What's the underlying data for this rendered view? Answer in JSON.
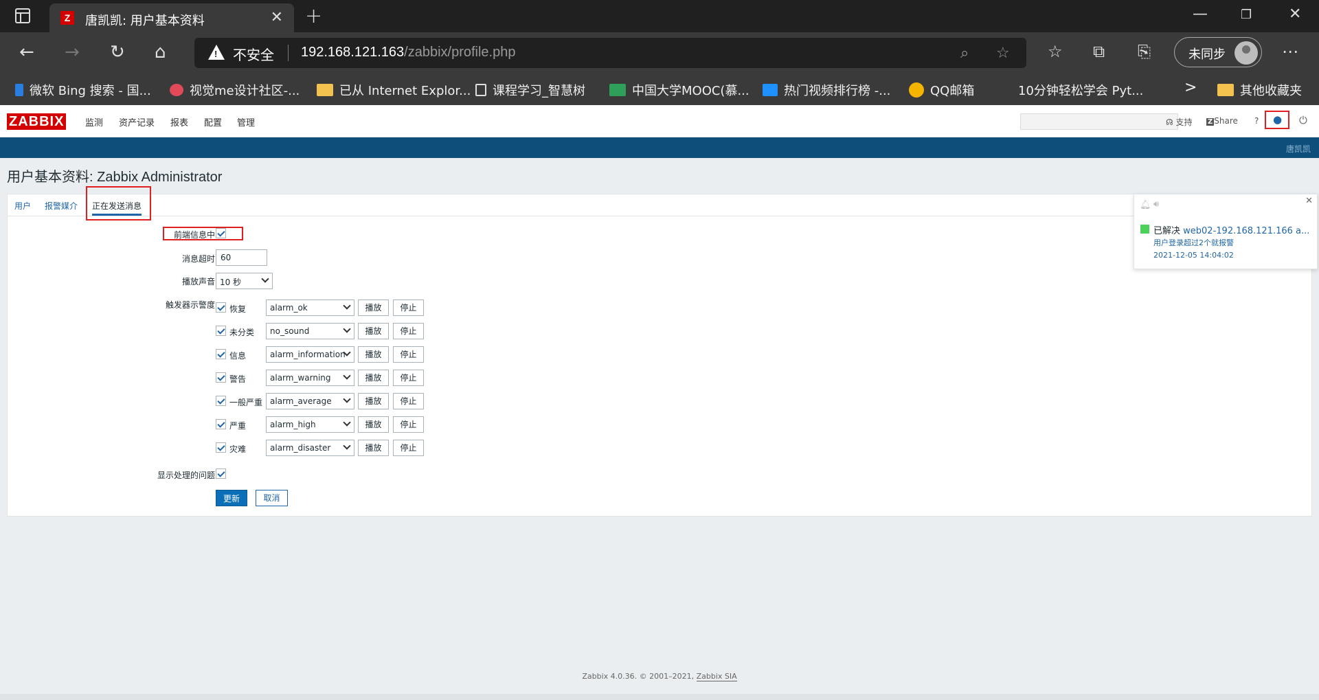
{
  "browser": {
    "tab_title": "唐凯凯: 用户基本资料",
    "tab_favicon": "Z",
    "address_insecure": "不安全",
    "address_host": "192.168.121.163",
    "address_path": "/zabbix/profile.php",
    "sync_label": "未同步",
    "bookmarks": [
      {
        "label": "微软 Bing 搜索 - 国...",
        "color": "#2a7de1"
      },
      {
        "label": "视觉me设计社区-...",
        "color": "#e24a5a"
      },
      {
        "label": "已从 Internet Explor...",
        "color": "#f2c14e"
      },
      {
        "label": "课程学习_智慧树",
        "color": "#e0e0e0"
      },
      {
        "label": "中国大学MOOC(慕...",
        "color": "#2fa05a"
      },
      {
        "label": "热门视频排行榜 -...",
        "color": "#1e90ff"
      },
      {
        "label": "QQ邮箱",
        "color": "#f4b400"
      },
      {
        "label": "10分钟轻松学会 Pyt...",
        "color": "#3a3a3a"
      },
      {
        "label": "其他收藏夹",
        "color": "#f2c14e"
      }
    ]
  },
  "app": {
    "logo": "ZABBIX",
    "menu": [
      "监测",
      "资产记录",
      "报表",
      "配置",
      "管理"
    ],
    "header_links": {
      "support": "支持",
      "share": "Share",
      "help": "?"
    },
    "username": "唐凯凯",
    "page_title": "用户基本资料: Zabbix Administrator",
    "tabs": [
      "用户",
      "报警媒介",
      "正在发送消息"
    ],
    "form": {
      "frontend_messaging_label": "前端信息中",
      "frontend_messaging_checked": true,
      "timeout_label": "消息超时",
      "timeout_value": "60",
      "play_sound_label": "播放声音",
      "play_sound_value": "10 秒",
      "trigger_severity_label": "触发器示警度",
      "severities": [
        {
          "name": "恢复",
          "sound": "alarm_ok",
          "checked": true
        },
        {
          "name": "未分类",
          "sound": "no_sound",
          "checked": true
        },
        {
          "name": "信息",
          "sound": "alarm_information",
          "checked": true
        },
        {
          "name": "警告",
          "sound": "alarm_warning",
          "checked": true
        },
        {
          "name": "一般严重",
          "sound": "alarm_average",
          "checked": true
        },
        {
          "name": "严重",
          "sound": "alarm_high",
          "checked": true
        },
        {
          "name": "灾难",
          "sound": "alarm_disaster",
          "checked": true
        }
      ],
      "play_button": "播放",
      "stop_button": "停止",
      "show_suppressed_label": "显示处理的问题",
      "show_suppressed_checked": true,
      "update_button": "更新",
      "cancel_button": "取消"
    },
    "notification": {
      "status": "已解决",
      "host": "web02-192.168.121.166 a...",
      "message": "用户登录超过2个就报警",
      "time": "2021-12-05 14:04:02",
      "status_color": "#4cd25b"
    },
    "footer": {
      "text": "Zabbix 4.0.36. © 2001–2021,",
      "link": "Zabbix SIA"
    }
  }
}
